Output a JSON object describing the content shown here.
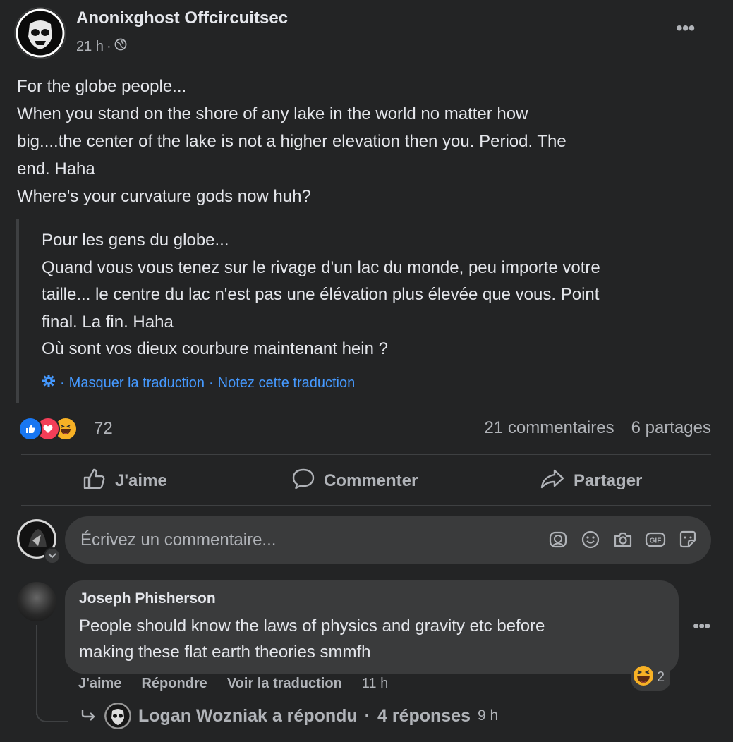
{
  "post": {
    "author": "Anonixghost Offcircuitsec",
    "time": "21 h",
    "separator": "·",
    "audience_icon": "globe-icon",
    "more_icon": "more-horizontal-icon",
    "text_lines": [
      "For the globe people...",
      "When you stand on the shore of any lake in the world no matter how",
      "big....the center of the lake is not a higher elevation then you. Period. The",
      "end. Haha",
      "Where's your curvature gods now huh?"
    ],
    "translation_lines": [
      "Pour les gens du globe...",
      "Quand vous vous tenez sur le rivage d'un lac du monde, peu importe votre",
      "taille... le centre du lac n'est pas une élévation plus élevée que vous. Point",
      "final. La fin. Haha",
      "Où sont vos dieux courbure maintenant hein ?"
    ],
    "hide_translation": "Masquer la traduction",
    "rate_translation": "Notez cette traduction",
    "reactions_count": "72",
    "comments_count": "21 commentaires",
    "shares_count": "6 partages"
  },
  "actions": {
    "like": "J'aime",
    "comment": "Commenter",
    "share": "Partager"
  },
  "composer": {
    "placeholder": "Écrivez un commentaire..."
  },
  "comment": {
    "author": "Joseph Phisherson",
    "lines": [
      "People should know the laws of physics and gravity etc before",
      "making these flat earth theories smmfh"
    ],
    "reaction_count": "2",
    "like": "J'aime",
    "reply": "Répondre",
    "see_translation": "Voir la traduction",
    "time": "11 h"
  },
  "reply": {
    "text": "Logan Wozniak a répondu",
    "separator": "·",
    "count": "4 réponses",
    "time": "9 h"
  },
  "colors": {
    "background": "#232425",
    "surface": "#3a3b3c",
    "text": "#e4e6eb",
    "muted": "#b0b3b8",
    "link": "#4599ff",
    "like_blue": "#1877f2",
    "love_red": "#f33e58",
    "haha_yellow": "#f7b125"
  }
}
